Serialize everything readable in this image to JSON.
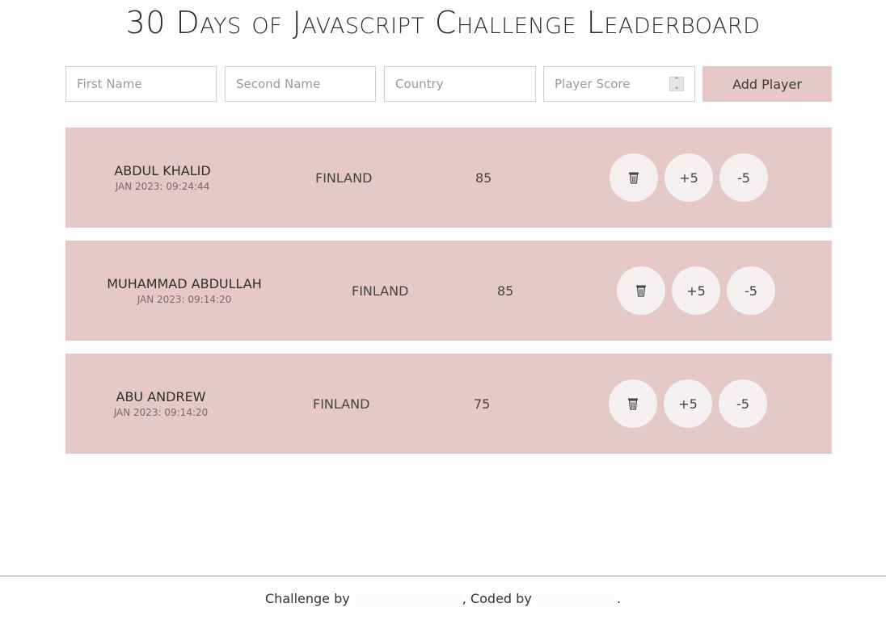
{
  "page": {
    "title": "30 Days of Javascript Challenge Leaderboard"
  },
  "form": {
    "first_name_placeholder": "First Name",
    "second_name_placeholder": "Second Name",
    "country_placeholder": "Country",
    "score_placeholder": "Player Score",
    "add_button_label": "Add Player"
  },
  "players": [
    {
      "name": "Abdul Khalid",
      "date": "JAN 2023: 09:24:44",
      "country": "Finland",
      "score": "85",
      "delete_icon": "trash-icon",
      "plus_label": "+5",
      "minus_label": "-5"
    },
    {
      "name": "Muhammad Abdullah",
      "date": "JAN 2023: 09:14:20",
      "country": "Finland",
      "score": "85",
      "delete_icon": "trash-icon",
      "plus_label": "+5",
      "minus_label": "-5"
    },
    {
      "name": "Abu Andrew",
      "date": "JAN 2023: 09:14:20",
      "country": "Finland",
      "score": "75",
      "delete_icon": "trash-icon",
      "plus_label": "+5",
      "minus_label": "-5"
    }
  ],
  "footer": {
    "challenge_by": "Challenge by",
    "coded_by": ", Coded by",
    "period": "."
  },
  "colors": {
    "row_background": "#e5c9c7",
    "button_background": "#e5c9c7",
    "circle_button": "#f5f1f0"
  }
}
